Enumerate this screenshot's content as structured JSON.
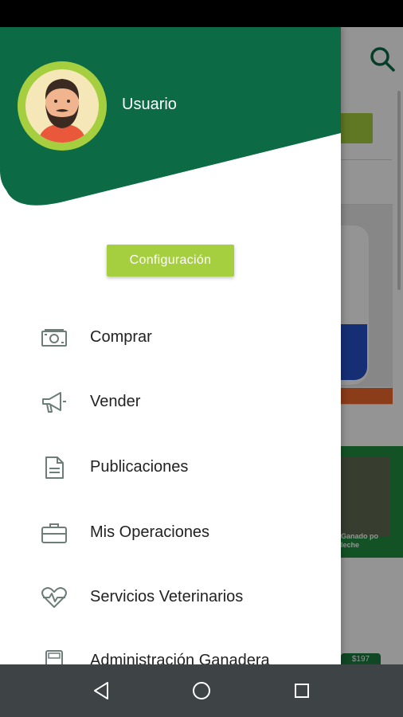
{
  "user": {
    "name": "Usuario"
  },
  "config_button": {
    "label": "Configuración"
  },
  "menu": [
    {
      "label": "Comprar",
      "icon": "money-icon"
    },
    {
      "label": "Vender",
      "icon": "megaphone-icon"
    },
    {
      "label": "Publicaciones",
      "icon": "document-icon"
    },
    {
      "label": "Mis Operaciones",
      "icon": "briefcase-icon"
    },
    {
      "label": "Servicios Veterinarios",
      "icon": "heart-pulse-icon"
    },
    {
      "label": "Administración Ganadera",
      "icon": "calculator-icon"
    }
  ],
  "background": {
    "promo_text": "Ganado po leche",
    "price_badge": "$197"
  },
  "colors": {
    "header_green": "#0c6a45",
    "accent_lime": "#a5cf3f",
    "icon_gray": "#6d7d7a",
    "navbar": "#3e4346"
  },
  "navbar": {
    "buttons": [
      "back-icon",
      "home-icon",
      "recents-icon"
    ]
  }
}
